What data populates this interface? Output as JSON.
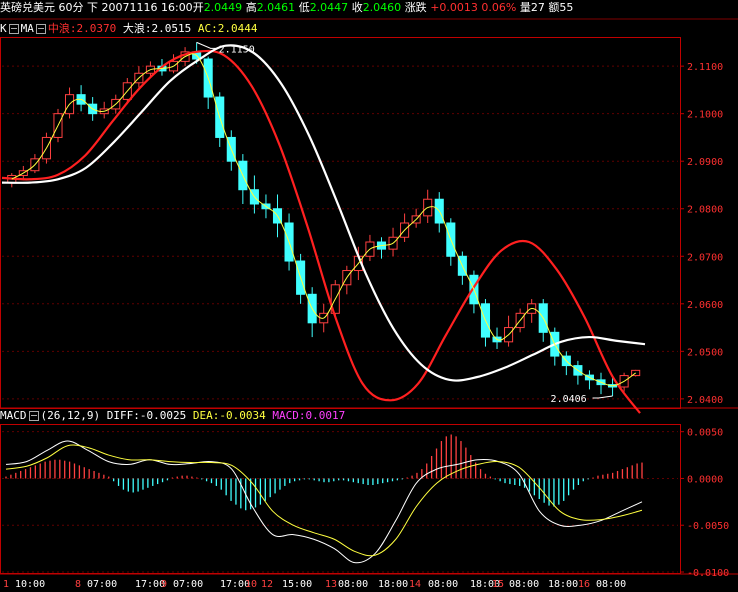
{
  "header": {
    "symbol": "英磅兑美元",
    "period": "60分",
    "dir": "下",
    "datetime": "20071116 16:00",
    "open_label": "开",
    "open": "2.0449",
    "high_label": "高",
    "high": "2.0461",
    "low_label": "低",
    "low": "2.0447",
    "close_label": "收",
    "close": "2.0460",
    "change_label": "涨跌",
    "change": "+0.0013",
    "pct": "0.06%",
    "vol_label": "量",
    "vol": "27",
    "amt_label": "额",
    "amt": "55"
  },
  "kline_legend": {
    "k": "K",
    "ma": "MA",
    "mid_label": "中浪:",
    "mid": "2.0370",
    "big_label": "大浪:",
    "big": "2.0515",
    "ac_label": "AC:",
    "ac": "2.0444"
  },
  "macd_legend": {
    "name": "MACD",
    "params": "(26,12,9)",
    "diff_label": "DIFF:",
    "diff": "-0.0025",
    "dea_label": "DEA:",
    "dea": "-0.0034",
    "macd_label": "MACD:",
    "macd": "0.0017"
  },
  "annotations": {
    "peak": "2.1150",
    "trough": "2.0406"
  },
  "colors": {
    "red": "#ff2020",
    "white": "#ffffff",
    "yellow": "#ffff40",
    "cyan": "#40ffff",
    "frame": "#c00000",
    "axis_text": "#ff3030"
  },
  "chart_data": [
    {
      "type": "candlestick",
      "price_ticks": [
        "2.1100",
        "2.1000",
        "2.0900",
        "2.0800",
        "2.0700",
        "2.0600",
        "2.0500",
        "2.0400"
      ],
      "ylim": [
        2.0385,
        2.1155
      ],
      "x_labels": [
        "1",
        "10:00",
        "8",
        "07:00",
        "17:00",
        "9",
        "07:00",
        "17:00",
        "10",
        "12",
        "15:00",
        "13",
        "08:00",
        "18:00",
        "14",
        "08:00",
        "18:00",
        "15",
        "08:00",
        "18:00",
        "16",
        "08:00"
      ],
      "series": [
        {
          "name": "中浪",
          "values": [
            2.0865,
            2.0862,
            2.0871,
            2.0912,
            2.0985,
            2.1056,
            2.1108,
            2.113,
            2.1123,
            2.1058,
            2.0935,
            2.0765,
            2.0575,
            2.0432,
            2.0397,
            2.0432,
            2.0534,
            2.0634,
            2.0712,
            2.073,
            2.0672,
            2.0572,
            2.0448,
            2.037
          ]
        },
        {
          "name": "大浪",
          "values": [
            2.0855,
            2.0855,
            2.0862,
            2.0886,
            2.094,
            2.1004,
            2.1068,
            2.1112,
            2.1143,
            2.1128,
            2.1062,
            2.0952,
            2.0812,
            2.0665,
            2.0548,
            2.0472,
            2.044,
            2.0446,
            2.0466,
            2.0493,
            2.052,
            2.053,
            2.0522,
            2.0515
          ]
        }
      ],
      "candles": [
        [
          2.0855,
          2.087,
          2.0845,
          2.0875
        ],
        [
          2.087,
          2.088,
          2.086,
          2.089
        ],
        [
          2.088,
          2.0905,
          2.0875,
          2.0915
        ],
        [
          2.0905,
          2.095,
          2.0895,
          2.096
        ],
        [
          2.095,
          2.1,
          2.094,
          2.101
        ],
        [
          2.1,
          2.104,
          2.099,
          2.1055
        ],
        [
          2.104,
          2.102,
          2.1005,
          2.106
        ],
        [
          2.102,
          2.1,
          2.0985,
          2.1035
        ],
        [
          2.1,
          2.101,
          2.099,
          2.1025
        ],
        [
          2.101,
          2.103,
          2.1,
          2.104
        ],
        [
          2.103,
          2.1065,
          2.102,
          2.1075
        ],
        [
          2.1065,
          2.1085,
          2.1055,
          2.11
        ],
        [
          2.1085,
          2.11,
          2.1075,
          2.111
        ],
        [
          2.11,
          2.109,
          2.108,
          2.1115
        ],
        [
          2.109,
          2.111,
          2.1085,
          2.1125
        ],
        [
          2.111,
          2.113,
          2.11,
          2.114
        ],
        [
          2.113,
          2.1115,
          2.1105,
          2.115
        ],
        [
          2.1115,
          2.1035,
          2.101,
          2.112
        ],
        [
          2.1035,
          2.095,
          2.093,
          2.1045
        ],
        [
          2.095,
          2.09,
          2.088,
          2.0965
        ],
        [
          2.09,
          2.084,
          2.081,
          2.0915
        ],
        [
          2.084,
          2.081,
          2.079,
          2.087
        ],
        [
          2.081,
          2.08,
          2.078,
          2.083
        ],
        [
          2.08,
          2.077,
          2.074,
          2.083
        ],
        [
          2.077,
          2.069,
          2.067,
          2.079
        ],
        [
          2.069,
          2.062,
          2.06,
          2.0705
        ],
        [
          2.062,
          2.056,
          2.053,
          2.0635
        ],
        [
          2.056,
          2.058,
          2.054,
          2.06
        ],
        [
          2.058,
          2.064,
          2.057,
          2.065
        ],
        [
          2.064,
          2.067,
          2.062,
          2.068
        ],
        [
          2.067,
          2.07,
          2.065,
          2.072
        ],
        [
          2.07,
          2.073,
          2.069,
          2.0745
        ],
        [
          2.073,
          2.0715,
          2.0695,
          2.074
        ],
        [
          2.0715,
          2.074,
          2.07,
          2.076
        ],
        [
          2.074,
          2.077,
          2.073,
          2.079
        ],
        [
          2.077,
          2.0785,
          2.076,
          2.08
        ],
        [
          2.0785,
          2.082,
          2.077,
          2.084
        ],
        [
          2.082,
          2.077,
          2.075,
          2.0835
        ],
        [
          2.077,
          2.07,
          2.068,
          2.078
        ],
        [
          2.07,
          2.066,
          2.064,
          2.071
        ],
        [
          2.066,
          2.06,
          2.058,
          2.067
        ],
        [
          2.06,
          2.053,
          2.051,
          2.061
        ],
        [
          2.053,
          2.052,
          2.0505,
          2.055
        ],
        [
          2.052,
          2.055,
          2.051,
          2.0575
        ],
        [
          2.055,
          2.058,
          2.054,
          2.059
        ],
        [
          2.058,
          2.06,
          2.056,
          2.061
        ],
        [
          2.06,
          2.054,
          2.052,
          2.061
        ],
        [
          2.054,
          2.049,
          2.047,
          2.055
        ],
        [
          2.049,
          2.047,
          2.045,
          2.05
        ],
        [
          2.047,
          2.045,
          2.043,
          2.048
        ],
        [
          2.045,
          2.044,
          2.042,
          2.046
        ],
        [
          2.044,
          2.043,
          2.041,
          2.0455
        ],
        [
          2.043,
          2.0425,
          2.0406,
          2.0445
        ],
        [
          2.0425,
          2.0449,
          2.0415,
          2.0455
        ],
        [
          2.0449,
          2.046,
          2.0447,
          2.0461
        ]
      ]
    },
    {
      "type": "bar",
      "title": "MACD",
      "tick_labels": [
        "0.0050",
        "0.0000",
        "-0.0050",
        "-0.0100"
      ],
      "ylim": [
        -0.01,
        0.0055
      ],
      "values": [
        0.0002,
        0.0004,
        0.0006,
        0.0008,
        0.001,
        0.0012,
        0.0014,
        0.0016,
        0.0018,
        0.0019,
        0.002,
        0.002,
        0.0019,
        0.0018,
        0.0016,
        0.0014,
        0.0012,
        0.001,
        0.0008,
        0.0006,
        0.0004,
        0.0002,
        -0.0003,
        -0.0008,
        -0.0012,
        -0.0014,
        -0.0015,
        -0.0014,
        -0.0012,
        -0.001,
        -0.0008,
        -0.0006,
        -0.0004,
        -0.0002,
        0.0001,
        0.0002,
        0.0003,
        0.0003,
        0.0002,
        0.0001,
        -0.0001,
        -0.0003,
        -0.0005,
        -0.0008,
        -0.0012,
        -0.0018,
        -0.0024,
        -0.0028,
        -0.0032,
        -0.0034,
        -0.0033,
        -0.0031,
        -0.0028,
        -0.0024,
        -0.002,
        -0.0016,
        -0.0012,
        -0.0008,
        -0.0005,
        -0.0003,
        -0.0002,
        -0.0001,
        -0.0001,
        -0.0002,
        -0.0003,
        -0.0004,
        -0.0004,
        -0.0003,
        -0.0002,
        -0.0002,
        -0.0003,
        -0.0004,
        -0.0005,
        -0.0006,
        -0.0007,
        -0.0007,
        -0.0006,
        -0.0005,
        -0.0004,
        -0.0003,
        -0.0002,
        -0.0001,
        0.0001,
        0.0003,
        0.0006,
        0.001,
        0.0016,
        0.0024,
        0.0032,
        0.004,
        0.0045,
        0.0047,
        0.0045,
        0.004,
        0.0033,
        0.0025,
        0.0017,
        0.001,
        0.0005,
        0.0002,
        -0.0001,
        -0.0003,
        -0.0005,
        -0.0006,
        -0.0007,
        -0.0008,
        -0.001,
        -0.0014,
        -0.0018,
        -0.0022,
        -0.0026,
        -0.0029,
        -0.003,
        -0.0028,
        -0.0024,
        -0.0018,
        -0.0012,
        -0.0007,
        -0.0003,
        -0.0001,
        0.0001,
        0.0003,
        0.0004,
        0.0005,
        0.0006,
        0.0008,
        0.001,
        0.0012,
        0.0014,
        0.0016,
        0.0017
      ],
      "series": [
        {
          "name": "DIFF",
          "values": [
            0.0015,
            0.0018,
            0.003,
            0.004,
            0.003,
            0.0018,
            0.0015,
            0.002,
            0.0015,
            0.0016,
            0.0018,
            0.001,
            -0.003,
            -0.006,
            -0.006,
            -0.0065,
            -0.0075,
            -0.009,
            -0.008,
            -0.0045,
            -0.0005,
            0.001,
            0.0015,
            0.002,
            0.0018,
            0.0005,
            -0.0035,
            -0.005,
            -0.005,
            -0.0045,
            -0.0035,
            -0.0025
          ]
        },
        {
          "name": "DEA",
          "values": [
            0.001,
            0.0013,
            0.0022,
            0.0035,
            0.0033,
            0.0025,
            0.002,
            0.002,
            0.0018,
            0.0017,
            0.0017,
            0.0014,
            -0.0005,
            -0.0035,
            -0.005,
            -0.0058,
            -0.0065,
            -0.0078,
            -0.0082,
            -0.0065,
            -0.003,
            -0.0005,
            0.0008,
            0.0015,
            0.0018,
            0.0012,
            -0.001,
            -0.0035,
            -0.0044,
            -0.0044,
            -0.004,
            -0.0034
          ]
        }
      ]
    }
  ]
}
